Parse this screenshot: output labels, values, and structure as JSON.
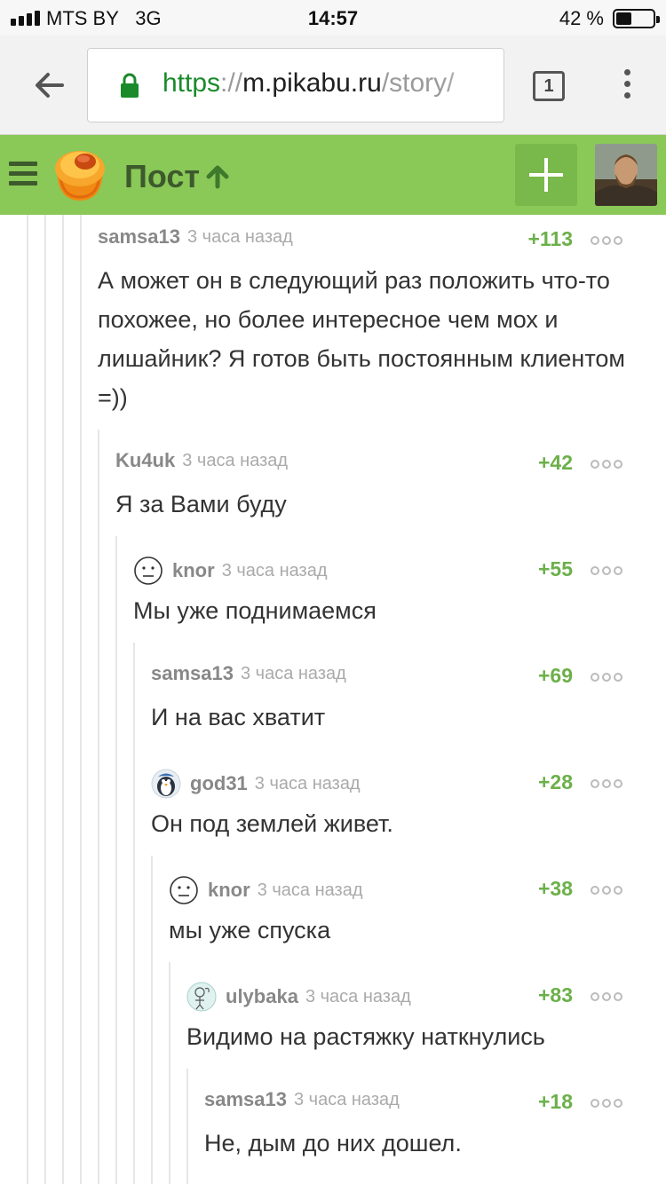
{
  "statusbar": {
    "carrier": "MTS BY",
    "network": "3G",
    "time": "14:57",
    "battery": "42 %",
    "battery_level": 0.42
  },
  "browser": {
    "url_scheme": "https",
    "url_sep": "://",
    "url_host": "m.pikabu.ru",
    "url_path": "/story/",
    "tabs_count": "1"
  },
  "header": {
    "title": "Пост",
    "accent": "#8ac858"
  },
  "comments": [
    {
      "author": "samsa13",
      "time": "3 часа назад",
      "rating": "+113",
      "avatar": "",
      "text": "А может он в следующий раз положить что-то похожее, но более интересное чем мох и лишайник? Я готов быть постоянным клиентом =))"
    },
    {
      "author": "Ku4uk",
      "time": "3 часа назад",
      "rating": "+42",
      "avatar": "",
      "text": "Я за Вами буду"
    },
    {
      "author": "knor",
      "time": "3 часа назад",
      "rating": "+55",
      "avatar": "neutral-face-icon",
      "text": "Мы уже поднимаемся"
    },
    {
      "author": "samsa13",
      "time": "3 часа назад",
      "rating": "+69",
      "avatar": "",
      "text": "И на вас хватит"
    },
    {
      "author": "god31",
      "time": "3 часа назад",
      "rating": "+28",
      "avatar": "penguin-icon",
      "text": "Он под землей живет."
    },
    {
      "author": "knor",
      "time": "3 часа назад",
      "rating": "+38",
      "avatar": "neutral-face-icon",
      "text": "мы уже спуска"
    },
    {
      "author": "ulybaka",
      "time": "3 часа назад",
      "rating": "+83",
      "avatar": "sketch-avatar-icon",
      "text": "Видимо на растяжку наткнулись"
    },
    {
      "author": "samsa13",
      "time": "3 часа назад",
      "rating": "+18",
      "avatar": "",
      "text": "Не, дым до них дошел."
    }
  ]
}
